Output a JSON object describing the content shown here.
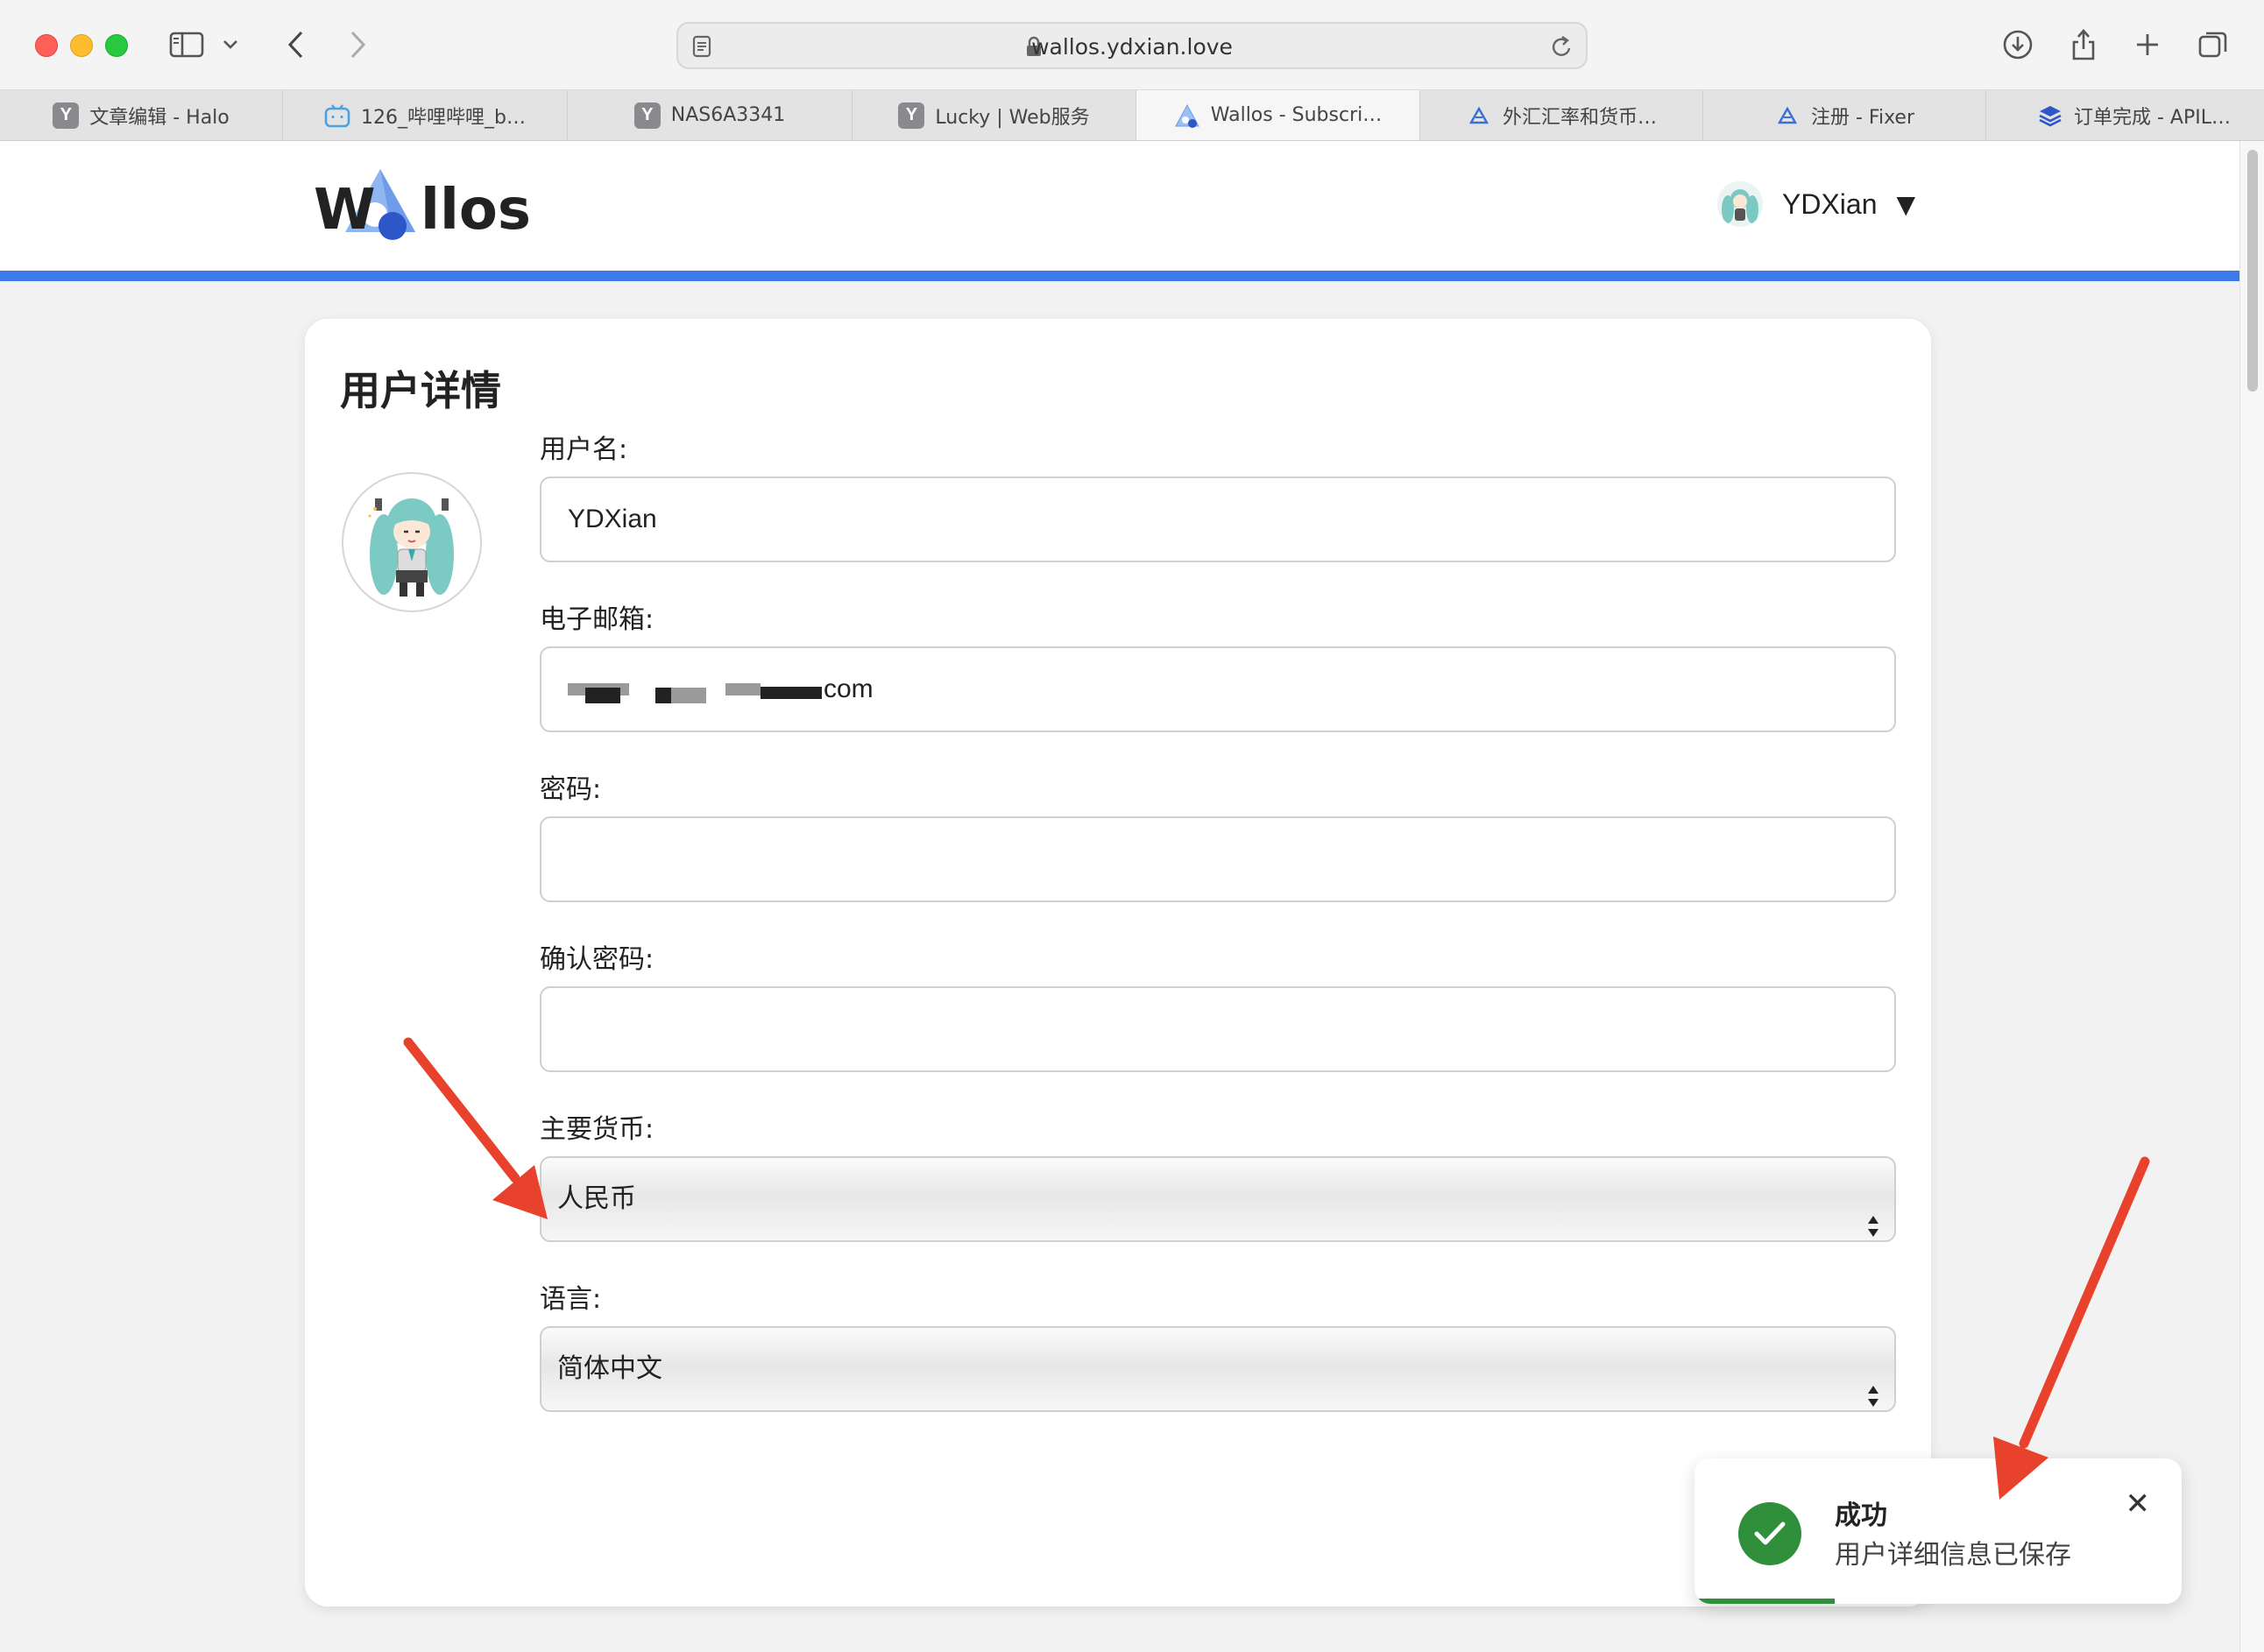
{
  "browser": {
    "url": "wallos.ydxian.love",
    "tabs": [
      {
        "label": "文章编辑 - Halo",
        "favicon": "y-icon",
        "active": false
      },
      {
        "label": "126_哔哩哔哩_b…",
        "favicon": "bilibili-icon",
        "active": false
      },
      {
        "label": "NAS6A3341",
        "favicon": "y-icon",
        "active": false
      },
      {
        "label": "Lucky | Web服务",
        "favicon": "y-icon",
        "active": false
      },
      {
        "label": "Wallos - Subscri…",
        "favicon": "wallos-icon",
        "active": true
      },
      {
        "label": "外汇汇率和货币…",
        "favicon": "fixer-icon",
        "active": false
      },
      {
        "label": "注册 - Fixer",
        "favicon": "fixer-icon",
        "active": false
      },
      {
        "label": "订单完成 - APIL…",
        "favicon": "apilayer-icon",
        "active": false
      }
    ]
  },
  "header": {
    "logo_text_left": "W",
    "logo_text_right": "llos",
    "user_name": "YDXian",
    "caret": "▼",
    "accent_color": "#3b7ae8"
  },
  "profile": {
    "title": "用户详情",
    "username_label": "用户名:",
    "username_value": "YDXian",
    "email_label": "电子邮箱:",
    "email_value_visible": "com",
    "password_label": "密码:",
    "password_value": "",
    "confirm_password_label": "确认密码:",
    "confirm_password_value": "",
    "currency_label": "主要货币:",
    "currency_value": "人民币",
    "language_label": "语言:",
    "language_value": "简体中文"
  },
  "toast": {
    "title": "成功",
    "message": "用户详细信息已保存",
    "close": "✕",
    "color": "#2f8f3a"
  },
  "annotations": {
    "arrow_color": "#e8412c"
  }
}
